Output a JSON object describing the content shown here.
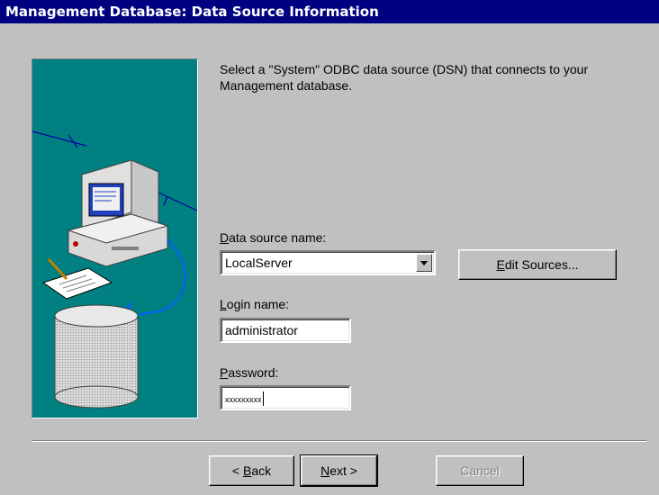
{
  "window": {
    "title": "Management Database: Data Source Information"
  },
  "description": "Select a \"System\" ODBC data source (DSN) that connects to your Management database.",
  "dsn": {
    "label_mnemonic": "D",
    "label_rest": "ata source name:",
    "value": "LocalServer"
  },
  "edit_sources": {
    "mnemonic": "E",
    "rest": "dit Sources..."
  },
  "login": {
    "label_mnemonic": "L",
    "label_rest": "ogin name:",
    "value": "administrator"
  },
  "password": {
    "label_mnemonic": "P",
    "label_rest": "assword:",
    "value": "xxxxxxxxx"
  },
  "buttons": {
    "back": {
      "prefix": "< ",
      "mnemonic": "B",
      "rest": "ack"
    },
    "next": {
      "mnemonic": "N",
      "rest": "ext >"
    },
    "cancel": "Cancel"
  },
  "illustration": {
    "icons": [
      "computer-icon",
      "clipboard-icon",
      "database-icon"
    ]
  },
  "colors": {
    "title_bg": "#000080",
    "panel_bg": "#008080",
    "window_bg": "#c0c0c0"
  }
}
